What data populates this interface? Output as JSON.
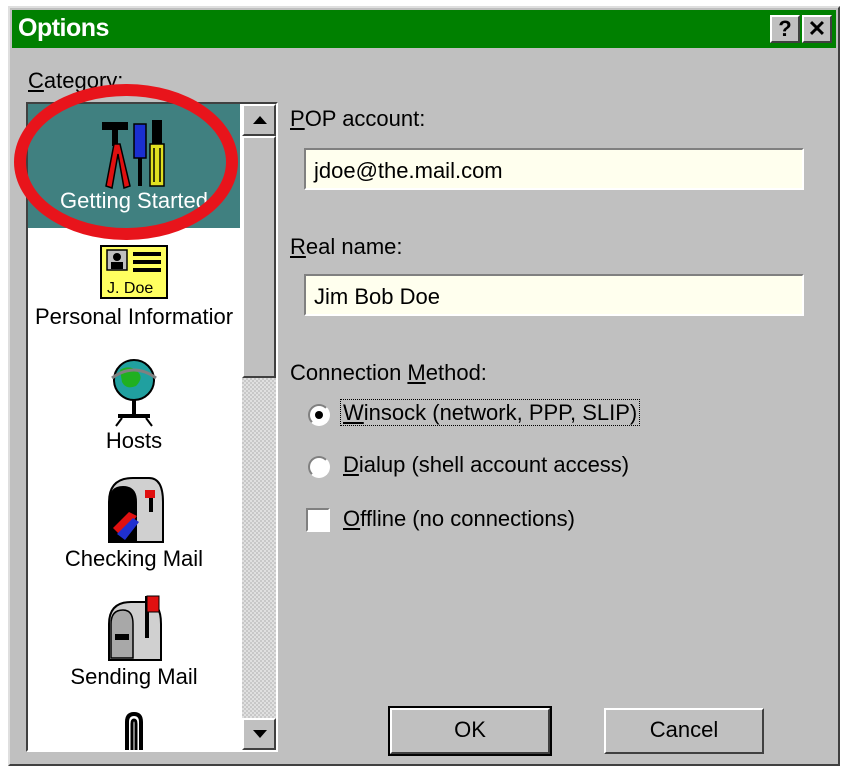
{
  "window": {
    "title": "Options",
    "help_icon": "help-icon",
    "close_icon": "close-icon",
    "help_glyph": "?",
    "close_glyph": "✕"
  },
  "category": {
    "label_prefix": "C",
    "label_rest": "ategory:",
    "items": [
      {
        "label": "Getting Started",
        "icon": "tools-icon",
        "selected": true
      },
      {
        "label": "Personal Informatior",
        "icon": "id-card-icon",
        "selected": false
      },
      {
        "label": "Hosts",
        "icon": "globe-network-icon",
        "selected": false
      },
      {
        "label": "Checking Mail",
        "icon": "mailbox-open-icon",
        "selected": false
      },
      {
        "label": "Sending Mail",
        "icon": "mailbox-flag-icon",
        "selected": false
      },
      {
        "label": "",
        "icon": "paperclip-icon",
        "selected": false
      }
    ],
    "id_card_text": "J. Doe"
  },
  "form": {
    "pop_label_prefix": "P",
    "pop_label_rest": "OP account:",
    "pop_value": "jdoe@the.mail.com",
    "realname_label_prefix": "R",
    "realname_label_rest": "eal name:",
    "realname_value": "Jim Bob Doe",
    "conn_label_a": "Connection ",
    "conn_label_u": "M",
    "conn_label_b": "ethod:",
    "options": [
      {
        "u": "W",
        "rest": "insock (network, PPP, SLIP)",
        "selected": true
      },
      {
        "u": "D",
        "rest": "ialup (shell account access)",
        "selected": false
      }
    ],
    "offline_u": "O",
    "offline_rest": "ffline (no connections)",
    "offline_checked": false
  },
  "buttons": {
    "ok": "OK",
    "cancel": "Cancel"
  },
  "colors": {
    "titlebar": "#008000",
    "selection": "#408080",
    "annotation": "#e8141b"
  }
}
